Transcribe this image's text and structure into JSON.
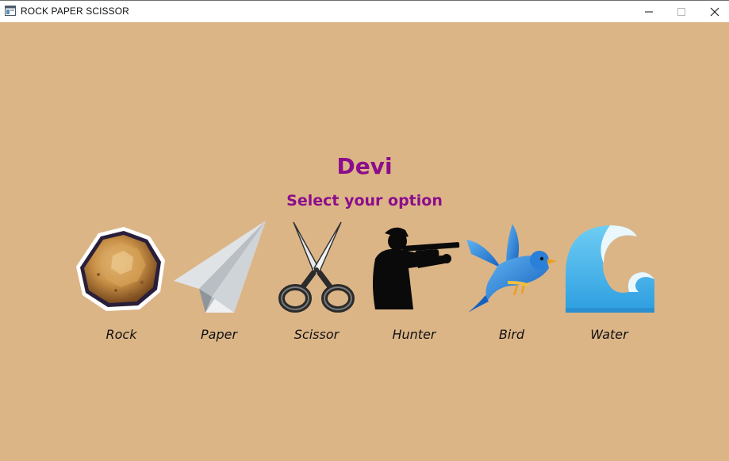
{
  "window": {
    "title": "ROCK PAPER SCISSOR",
    "minimize_icon": "minimize-icon",
    "maximize_icon": "maximize-icon",
    "close_icon": "close-icon"
  },
  "main": {
    "player_name": "Devi",
    "prompt": "Select your option",
    "options": [
      {
        "label": "Rock",
        "icon": "rock-icon"
      },
      {
        "label": "Paper",
        "icon": "paper-plane-icon"
      },
      {
        "label": "Scissor",
        "icon": "scissors-icon"
      },
      {
        "label": "Hunter",
        "icon": "hunter-icon"
      },
      {
        "label": "Bird",
        "icon": "bird-icon"
      },
      {
        "label": "Water",
        "icon": "water-wave-icon"
      }
    ]
  },
  "colors": {
    "background": "#dcb587",
    "heading": "#8b0d8b",
    "label": "#111111"
  }
}
